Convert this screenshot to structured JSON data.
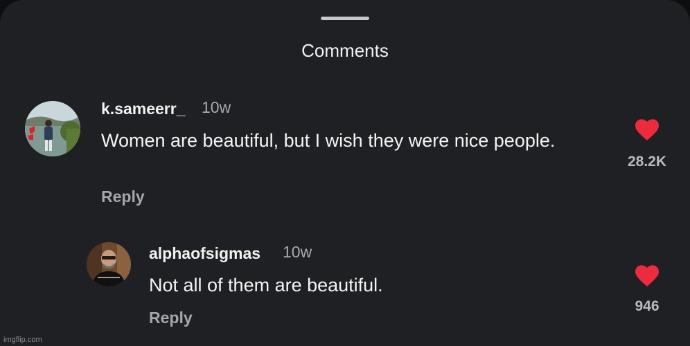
{
  "sheet": {
    "title": "Comments"
  },
  "comments": [
    {
      "username": "k.sameerr_",
      "time": "10w",
      "text": "Women are beautiful, but I wish they were nice people.",
      "reply_label": "Reply",
      "likes": "28.2K"
    },
    {
      "username": "alphaofsigmas",
      "time": "10w",
      "text": "Not all of them are beautiful.",
      "reply_label": "Reply",
      "likes": "946"
    }
  ],
  "watermark": "imgflip.com",
  "colors": {
    "heart": "#ee2a3f",
    "background": "#1f2023"
  }
}
